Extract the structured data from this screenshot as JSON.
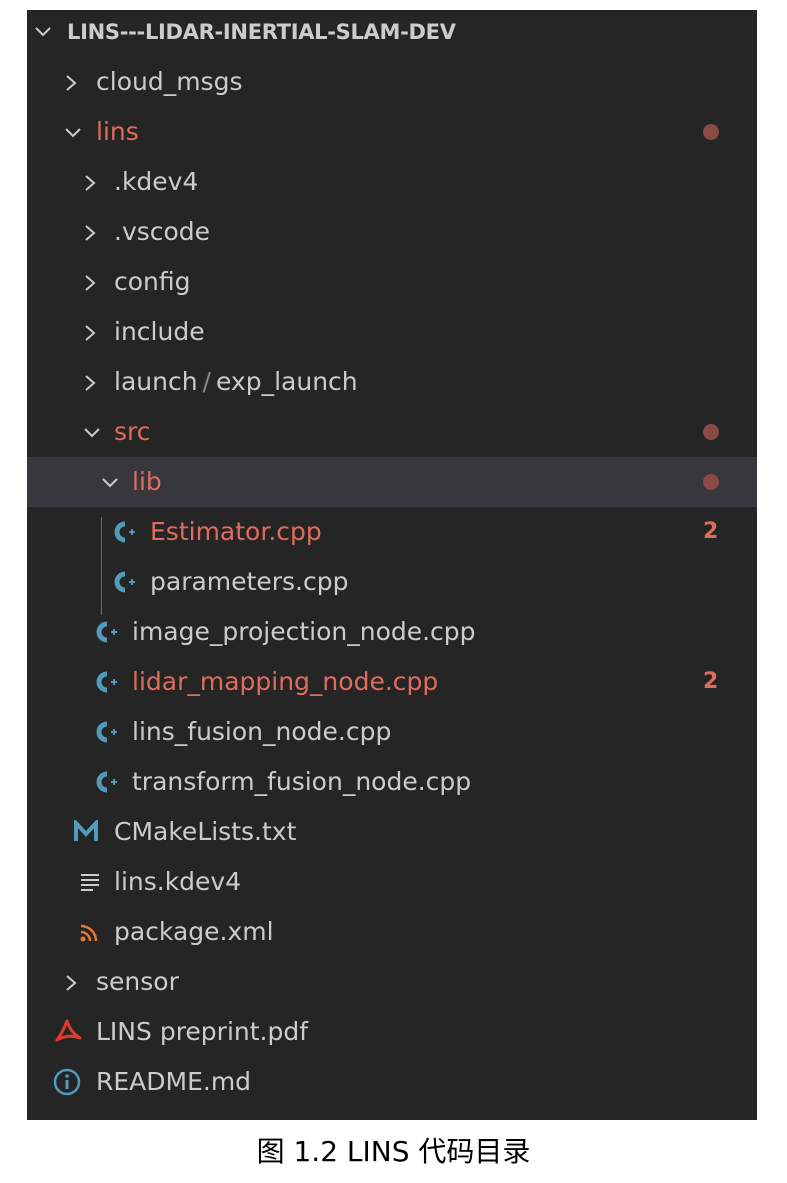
{
  "explorer": {
    "root_label": "LINS---LIDAR-INERTIAL-SLAM-DEV",
    "items": [
      {
        "label": "cloud_msgs"
      },
      {
        "label": "lins"
      },
      {
        "label": ".kdev4"
      },
      {
        "label": ".vscode"
      },
      {
        "label": "config"
      },
      {
        "label": "include"
      },
      {
        "label": "launch",
        "label_sub": "exp_launch",
        "separator": "/"
      },
      {
        "label": "src"
      },
      {
        "label": "lib"
      },
      {
        "label": "Estimator.cpp",
        "badge": "2"
      },
      {
        "label": "parameters.cpp"
      },
      {
        "label": "image_projection_node.cpp"
      },
      {
        "label": "lidar_mapping_node.cpp",
        "badge": "2"
      },
      {
        "label": "lins_fusion_node.cpp"
      },
      {
        "label": "transform_fusion_node.cpp"
      },
      {
        "label": "CMakeLists.txt"
      },
      {
        "label": "lins.kdev4"
      },
      {
        "label": "package.xml"
      },
      {
        "label": "sensor"
      },
      {
        "label": "LINS preprint.pdf"
      },
      {
        "label": "README.md"
      }
    ]
  },
  "caption": "图 1.2 LINS 代码目录",
  "colors": {
    "background": "#252526",
    "text": "#cccccc",
    "modified": "#e06c5c",
    "modified_dot": "#8b4a45",
    "cpp_icon": "#519aba",
    "cmake_icon": "#519aba",
    "xml_icon": "#e37933",
    "pdf_icon": "#e03c2c",
    "info_icon": "#519aba",
    "selected_row": "#37373d"
  },
  "icons": {
    "cpp": "cpp-file-icon",
    "cmake": "cmake-file-icon",
    "text": "text-file-icon",
    "xml": "rss-xml-icon",
    "pdf": "pdf-icon",
    "info": "info-icon"
  }
}
